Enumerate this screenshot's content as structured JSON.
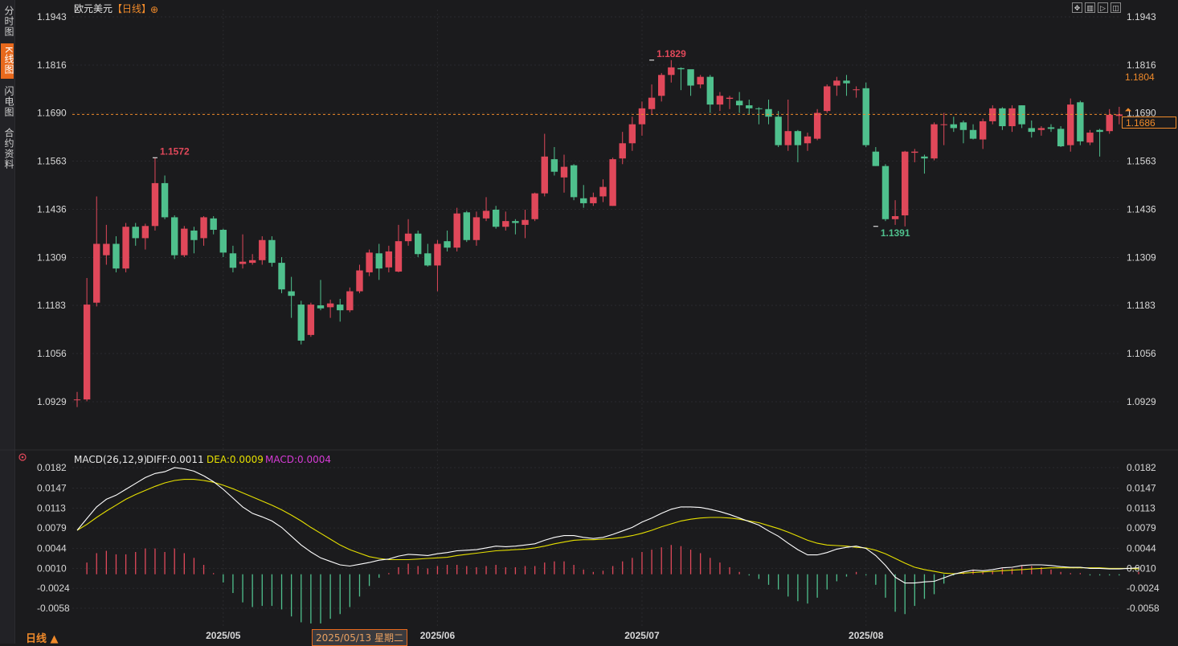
{
  "sidebar": {
    "tabs": [
      {
        "label": "分时图",
        "active": false
      },
      {
        "label": "K线图",
        "active": true
      },
      {
        "label": "闪电图",
        "active": false
      },
      {
        "label": "合约资料",
        "active": false
      }
    ]
  },
  "header": {
    "title": "欧元美元",
    "period_tag": "【日线】",
    "add_symbol": "⊕",
    "toolbar_icons": [
      "fullscreen-icon",
      "layout-icon",
      "play-icon",
      "window-icon"
    ]
  },
  "bottom": {
    "period_button": "日线 ▲",
    "crosshair_date": "2025/05/13 星期二"
  },
  "colors": {
    "up": "#e0485a",
    "down": "#4fc08d",
    "diff": "#ffffff",
    "dea": "#e6e000",
    "macd_label": "#d63bd6",
    "accent": "#f08a2a",
    "background": "#1b1b1d"
  },
  "price_tags": {
    "upper": "1.1804",
    "current": "1.1686"
  },
  "chart_data": [
    {
      "type": "candlestick",
      "series_name": "欧元美元 日线",
      "y_ticks": [
        "1.1943",
        "1.1816",
        "1.1690",
        "1.1563",
        "1.1436",
        "1.1309",
        "1.1183",
        "1.1056",
        "1.0929"
      ],
      "ylim": [
        1.0929,
        1.1943
      ],
      "x_labels": [
        "2025/05",
        "2025/06",
        "2025/07",
        "2025/08"
      ],
      "x_label_index": [
        15,
        37,
        58,
        81
      ],
      "annotations": [
        {
          "label": "1.1572",
          "index": 8,
          "value": 1.1572,
          "kind": "high"
        },
        {
          "label": "1.1829",
          "index": 59,
          "value": 1.1829,
          "kind": "high"
        },
        {
          "label": "1.1391",
          "index": 82,
          "value": 1.1391,
          "kind": "low"
        }
      ],
      "current_price_line": 1.1686,
      "candles": [
        [
          1.0935,
          1.0935,
          1.0915,
          1.0955
        ],
        [
          1.0935,
          1.1185,
          1.093,
          1.1255
        ],
        [
          1.119,
          1.1345,
          1.118,
          1.147
        ],
        [
          1.1315,
          1.1345,
          1.129,
          1.1395
        ],
        [
          1.1345,
          1.128,
          1.127,
          1.1365
        ],
        [
          1.128,
          1.139,
          1.127,
          1.14
        ],
        [
          1.139,
          1.136,
          1.134,
          1.14
        ],
        [
          1.136,
          1.1392,
          1.133,
          1.1398
        ],
        [
          1.1392,
          1.1505,
          1.138,
          1.1572
        ],
        [
          1.1505,
          1.1415,
          1.141,
          1.1525
        ],
        [
          1.1415,
          1.1315,
          1.1305,
          1.142
        ],
        [
          1.1315,
          1.1385,
          1.131,
          1.1392
        ],
        [
          1.138,
          1.1355,
          1.132,
          1.139
        ],
        [
          1.136,
          1.1415,
          1.134,
          1.1418
        ],
        [
          1.1412,
          1.1382,
          1.137,
          1.1418
        ],
        [
          1.1382,
          1.1322,
          1.131,
          1.1385
        ],
        [
          1.132,
          1.1282,
          1.127,
          1.134
        ],
        [
          1.1292,
          1.1298,
          1.128,
          1.137
        ],
        [
          1.1295,
          1.1302,
          1.129,
          1.1318
        ],
        [
          1.1302,
          1.1355,
          1.129,
          1.1365
        ],
        [
          1.1355,
          1.1295,
          1.1285,
          1.1365
        ],
        [
          1.1295,
          1.1225,
          1.1215,
          1.131
        ],
        [
          1.122,
          1.1208,
          1.115,
          1.1258
        ],
        [
          1.1185,
          1.109,
          1.108,
          1.1195
        ],
        [
          1.1105,
          1.1185,
          1.11,
          1.119
        ],
        [
          1.1183,
          1.1175,
          1.117,
          1.125
        ],
        [
          1.1178,
          1.1188,
          1.115,
          1.1198
        ],
        [
          1.1185,
          1.117,
          1.114,
          1.12
        ],
        [
          1.117,
          1.122,
          1.1165,
          1.123
        ],
        [
          1.122,
          1.1275,
          1.1215,
          1.129
        ],
        [
          1.127,
          1.1322,
          1.126,
          1.133
        ],
        [
          1.132,
          1.128,
          1.125,
          1.1345
        ],
        [
          1.1283,
          1.1325,
          1.127,
          1.134
        ],
        [
          1.1272,
          1.1352,
          1.127,
          1.1395
        ],
        [
          1.1352,
          1.1372,
          1.134,
          1.141
        ],
        [
          1.1372,
          1.1318,
          1.131,
          1.138
        ],
        [
          1.132,
          1.1288,
          1.1285,
          1.1345
        ],
        [
          1.1288,
          1.1345,
          1.122,
          1.1355
        ],
        [
          1.1352,
          1.1335,
          1.1325,
          1.138
        ],
        [
          1.1335,
          1.1425,
          1.1325,
          1.144
        ],
        [
          1.1428,
          1.1355,
          1.135,
          1.1432
        ],
        [
          1.1355,
          1.1415,
          1.134,
          1.143
        ],
        [
          1.1412,
          1.1432,
          1.1405,
          1.1468
        ],
        [
          1.1435,
          1.139,
          1.1385,
          1.1445
        ],
        [
          1.139,
          1.1405,
          1.138,
          1.143
        ],
        [
          1.1405,
          1.14,
          1.137,
          1.141
        ],
        [
          1.1395,
          1.1408,
          1.136,
          1.1435
        ],
        [
          1.141,
          1.1478,
          1.1405,
          1.148
        ],
        [
          1.1478,
          1.1575,
          1.147,
          1.1635
        ],
        [
          1.1568,
          1.1535,
          1.1525,
          1.16
        ],
        [
          1.152,
          1.1548,
          1.148,
          1.158
        ],
        [
          1.1552,
          1.1468,
          1.146,
          1.1555
        ],
        [
          1.1465,
          1.1452,
          1.144,
          1.15
        ],
        [
          1.1452,
          1.1468,
          1.1445,
          1.148
        ],
        [
          1.147,
          1.1495,
          1.1455,
          1.1515
        ],
        [
          1.1445,
          1.1568,
          1.1445,
          1.1572
        ],
        [
          1.157,
          1.161,
          1.1555,
          1.164
        ],
        [
          1.161,
          1.166,
          1.159,
          1.168
        ],
        [
          1.166,
          1.1702,
          1.163,
          1.172
        ],
        [
          1.17,
          1.173,
          1.1685,
          1.1765
        ],
        [
          1.1735,
          1.179,
          1.172,
          1.1795
        ],
        [
          1.179,
          1.181,
          1.177,
          1.1829
        ],
        [
          1.1808,
          1.1805,
          1.175,
          1.181
        ],
        [
          1.1805,
          1.1762,
          1.1735,
          1.18
        ],
        [
          1.1765,
          1.1785,
          1.1755,
          1.179
        ],
        [
          1.1785,
          1.1712,
          1.169,
          1.179
        ],
        [
          1.1712,
          1.1735,
          1.1695,
          1.1745
        ],
        [
          1.1727,
          1.173,
          1.17,
          1.1735
        ],
        [
          1.1722,
          1.171,
          1.169,
          1.1745
        ],
        [
          1.171,
          1.1702,
          1.1685,
          1.1725
        ],
        [
          1.1702,
          1.17,
          1.166,
          1.1705
        ],
        [
          1.17,
          1.168,
          1.166,
          1.1725
        ],
        [
          1.168,
          1.1605,
          1.16,
          1.1695
        ],
        [
          1.1605,
          1.1642,
          1.159,
          1.1725
        ],
        [
          1.1642,
          1.1605,
          1.156,
          1.1645
        ],
        [
          1.161,
          1.1628,
          1.159,
          1.1638
        ],
        [
          1.1622,
          1.169,
          1.1618,
          1.17
        ],
        [
          1.1695,
          1.176,
          1.169,
          1.1765
        ],
        [
          1.1762,
          1.1775,
          1.1735,
          1.1785
        ],
        [
          1.1775,
          1.1768,
          1.1735,
          1.179
        ],
        [
          1.1752,
          1.1752,
          1.173,
          1.176
        ],
        [
          1.1755,
          1.1605,
          1.16,
          1.177
        ],
        [
          1.1588,
          1.155,
          1.155,
          1.16
        ],
        [
          1.155,
          1.141,
          1.1405,
          1.1555
        ],
        [
          1.141,
          1.1418,
          1.1395,
          1.146
        ],
        [
          1.142,
          1.1588,
          1.1391,
          1.159
        ],
        [
          1.1585,
          1.1588,
          1.156,
          1.1595
        ],
        [
          1.1575,
          1.157,
          1.153,
          1.158
        ],
        [
          1.157,
          1.166,
          1.1565,
          1.1665
        ],
        [
          1.166,
          1.166,
          1.1605,
          1.169
        ],
        [
          1.166,
          1.165,
          1.164,
          1.168
        ],
        [
          1.1665,
          1.1645,
          1.161,
          1.167
        ],
        [
          1.1645,
          1.1622,
          1.162,
          1.166
        ],
        [
          1.162,
          1.1668,
          1.1595,
          1.1675
        ],
        [
          1.1668,
          1.1702,
          1.166,
          1.171
        ],
        [
          1.1702,
          1.1655,
          1.1645,
          1.1705
        ],
        [
          1.1655,
          1.1702,
          1.164,
          1.171
        ],
        [
          1.171,
          1.166,
          1.165,
          1.171
        ],
        [
          1.165,
          1.164,
          1.1625,
          1.167
        ],
        [
          1.1645,
          1.165,
          1.163,
          1.1655
        ],
        [
          1.1652,
          1.1648,
          1.164,
          1.166
        ],
        [
          1.1648,
          1.1602,
          1.16,
          1.1655
        ],
        [
          1.1605,
          1.1712,
          1.1588,
          1.1728
        ],
        [
          1.1718,
          1.1615,
          1.1605,
          1.1722
        ],
        [
          1.1612,
          1.1638,
          1.1605,
          1.1645
        ],
        [
          1.1645,
          1.164,
          1.1575,
          1.1648
        ],
        [
          1.1642,
          1.1685,
          1.1635,
          1.17
        ],
        [
          1.1682,
          1.1686,
          1.166,
          1.1706
        ]
      ]
    },
    {
      "type": "macd",
      "title": "MACD(26,12,9)",
      "diff_label": "DIFF:0.0011",
      "dea_label": "DEA:0.0009",
      "macd_label": "MACD:0.0004",
      "y_ticks": [
        "0.0182",
        "0.0147",
        "0.0113",
        "0.0079",
        "0.0044",
        "0.0010",
        "-0.0024",
        "-0.0058"
      ],
      "ylim": [
        -0.0058,
        0.0182
      ],
      "diff": [
        0.0075,
        0.0095,
        0.0115,
        0.0128,
        0.0135,
        0.0145,
        0.0155,
        0.0165,
        0.0172,
        0.0175,
        0.0182,
        0.018,
        0.0176,
        0.0168,
        0.0158,
        0.0145,
        0.013,
        0.0115,
        0.0104,
        0.0098,
        0.0091,
        0.008,
        0.0065,
        0.005,
        0.0038,
        0.0028,
        0.0022,
        0.0016,
        0.0014,
        0.0017,
        0.002,
        0.0024,
        0.0026,
        0.0031,
        0.0034,
        0.0033,
        0.0032,
        0.0035,
        0.0037,
        0.004,
        0.0041,
        0.0042,
        0.0045,
        0.0048,
        0.0047,
        0.0048,
        0.005,
        0.0052,
        0.0058,
        0.0063,
        0.0066,
        0.0066,
        0.0063,
        0.0061,
        0.0063,
        0.0068,
        0.0074,
        0.008,
        0.0089,
        0.0096,
        0.0104,
        0.0111,
        0.0115,
        0.0115,
        0.0114,
        0.0111,
        0.0107,
        0.0102,
        0.0096,
        0.009,
        0.0084,
        0.0074,
        0.0065,
        0.0053,
        0.0042,
        0.0033,
        0.0033,
        0.0037,
        0.0043,
        0.0046,
        0.0048,
        0.0044,
        0.0032,
        0.0015,
        -0.0005,
        -0.0015,
        -0.0015,
        -0.0013,
        -0.0012,
        -0.0006,
        0.0,
        0.0004,
        0.0007,
        0.0006,
        0.0008,
        0.0011,
        0.0012,
        0.0015,
        0.0016,
        0.0016,
        0.0015,
        0.0013,
        0.0012,
        0.0012,
        0.001,
        0.001,
        0.0009,
        0.0009,
        0.001,
        0.0011
      ],
      "dea": [
        0.0075,
        0.0085,
        0.0097,
        0.0108,
        0.0118,
        0.0128,
        0.0136,
        0.0143,
        0.015,
        0.0156,
        0.016,
        0.0162,
        0.0162,
        0.016,
        0.0157,
        0.0152,
        0.0146,
        0.0139,
        0.0132,
        0.0125,
        0.0118,
        0.011,
        0.0101,
        0.0091,
        0.008,
        0.007,
        0.006,
        0.005,
        0.0042,
        0.0036,
        0.003,
        0.0027,
        0.0025,
        0.0025,
        0.0025,
        0.0026,
        0.0027,
        0.0028,
        0.0029,
        0.0032,
        0.0034,
        0.0036,
        0.0038,
        0.004,
        0.0041,
        0.0042,
        0.0043,
        0.0045,
        0.0048,
        0.0052,
        0.0055,
        0.0058,
        0.0059,
        0.0059,
        0.006,
        0.0061,
        0.0063,
        0.0066,
        0.007,
        0.0075,
        0.0081,
        0.0086,
        0.0091,
        0.0094,
        0.0096,
        0.0097,
        0.0097,
        0.0096,
        0.0094,
        0.0091,
        0.0088,
        0.0083,
        0.0078,
        0.0072,
        0.0065,
        0.0058,
        0.0053,
        0.005,
        0.0049,
        0.0048,
        0.0046,
        0.0045,
        0.0041,
        0.0035,
        0.0027,
        0.0019,
        0.0012,
        0.0008,
        0.0005,
        0.0002,
        0.0001,
        0.0002,
        0.0003,
        0.0004,
        0.0005,
        0.0006,
        0.0007,
        0.0008,
        0.0009,
        0.001,
        0.0011,
        0.0011,
        0.0011,
        0.0011,
        0.0011,
        0.0011,
        0.001,
        0.001,
        0.001,
        0.0009
      ]
    }
  ]
}
